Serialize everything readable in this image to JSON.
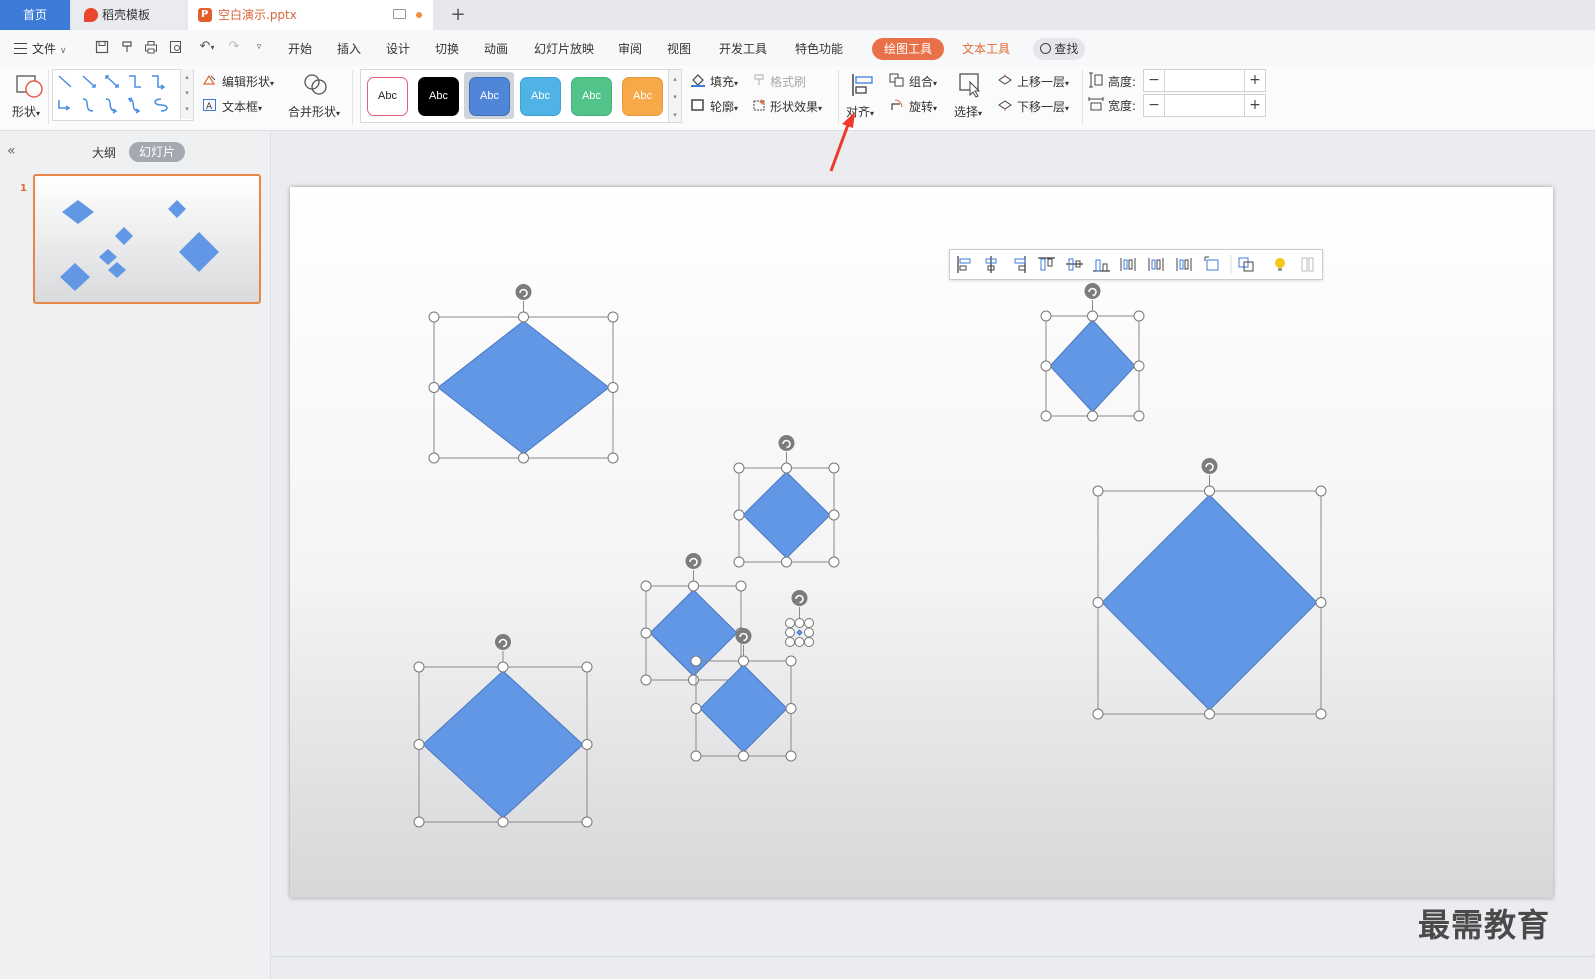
{
  "tabs": {
    "home": "首页",
    "template": "稻壳模板",
    "document": "空白演示.pptx"
  },
  "menu": {
    "file": "文件",
    "items": [
      "开始",
      "插入",
      "设计",
      "切换",
      "动画",
      "幻灯片放映",
      "审阅",
      "视图",
      "开发工具",
      "特色功能"
    ],
    "drawing_tools": "绘图工具",
    "text_tools": "文本工具",
    "search": "查找"
  },
  "ribbon": {
    "shape": "形状",
    "edit_shape": "编辑形状",
    "text_box": "文本框",
    "merge_shape": "合并形状",
    "style_samples": [
      {
        "label": "Abc",
        "bg": "#ffffff",
        "fg": "#222222",
        "border": "#e0627a"
      },
      {
        "label": "Abc",
        "bg": "#000000",
        "fg": "#ffffff",
        "border": "#000000"
      },
      {
        "label": "Abc",
        "bg": "#4f86d8",
        "fg": "#ffffff",
        "border": "#3a6fc0"
      },
      {
        "label": "Abc",
        "bg": "#4fb3e6",
        "fg": "#ffffff",
        "border": "#3ea2d6"
      },
      {
        "label": "Abc",
        "bg": "#52c48a",
        "fg": "#ffffff",
        "border": "#41b37a"
      },
      {
        "label": "Abc",
        "bg": "#f7a94a",
        "fg": "#ffffff",
        "border": "#e8983a"
      }
    ],
    "fill": "填充",
    "format_painter": "格式刷",
    "outline": "轮廓",
    "shape_effect": "形状效果",
    "align": "对齐",
    "group": "组合",
    "rotate": "旋转",
    "select": "选择",
    "bring_forward": "上移一层",
    "send_backward": "下移一层",
    "height_label": "高度:",
    "width_label": "宽度:",
    "height_value": "",
    "width_value": ""
  },
  "left_panel": {
    "outline": "大纲",
    "slides": "幻灯片",
    "slide_number": "1"
  },
  "slide": {
    "shape_color": "#6197e4",
    "shape_stroke": "#4a78c2"
  },
  "watermark": "最需教育"
}
